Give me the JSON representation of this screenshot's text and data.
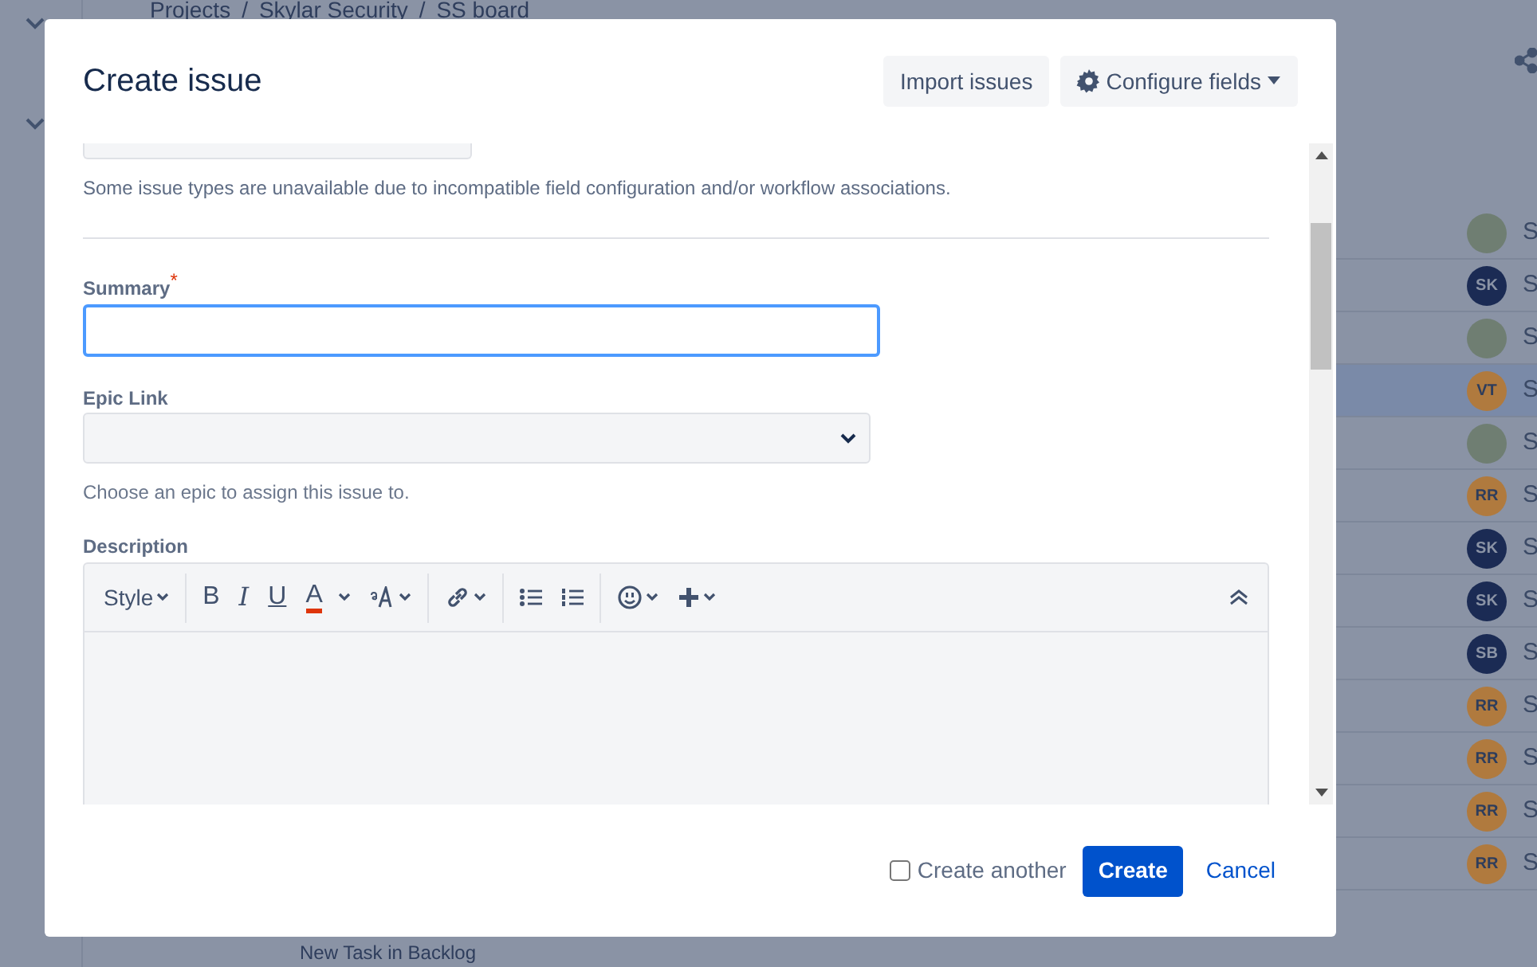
{
  "background": {
    "breadcrumb": {
      "separator": "/",
      "items": [
        "Projects",
        "Skylar Security",
        "SS board"
      ]
    },
    "rows": [
      {
        "kind": "photo",
        "selected": false,
        "key": "S"
      },
      {
        "kind": "initials",
        "initials": "SK",
        "color": "#1b2b54",
        "selected": false,
        "key": "S"
      },
      {
        "kind": "photo",
        "selected": false,
        "key": "S"
      },
      {
        "kind": "initials",
        "initials": "VT",
        "color": "#b07a3e",
        "selected": true,
        "key": "S"
      },
      {
        "kind": "photo",
        "selected": false,
        "key": "S"
      },
      {
        "kind": "initials",
        "initials": "RR",
        "color": "#b07a3e",
        "selected": false,
        "key": "S"
      },
      {
        "kind": "initials",
        "initials": "SK",
        "color": "#1b2b54",
        "selected": false,
        "key": "S"
      },
      {
        "kind": "initials",
        "initials": "SK",
        "color": "#1b2b54",
        "selected": false,
        "key": "S"
      },
      {
        "kind": "initials",
        "initials": "SB",
        "color": "#1b2b54",
        "selected": false,
        "key": "S"
      },
      {
        "kind": "initials",
        "initials": "RR",
        "color": "#b07a3e",
        "selected": false,
        "key": "S"
      },
      {
        "kind": "initials",
        "initials": "RR",
        "color": "#b07a3e",
        "selected": false,
        "key": "S"
      },
      {
        "kind": "initials",
        "initials": "RR",
        "color": "#b07a3e",
        "selected": false,
        "key": "S"
      },
      {
        "kind": "initials",
        "initials": "RR",
        "color": "#b07a3e",
        "selected": false,
        "key": "S"
      }
    ],
    "backlog_text": "New Task in Backlog"
  },
  "dialog": {
    "title": "Create issue",
    "header_buttons": [
      {
        "label": "Import issues",
        "kind": "plain"
      },
      {
        "label": "Configure fields",
        "kind": "settings"
      }
    ],
    "issue_type_note": "Some issue types are unavailable due to incompatible field configuration and/or workflow associations.",
    "summary": {
      "label": "Summary",
      "required_mark": "*",
      "focused": true
    },
    "epic_link": {
      "label": "Epic Link",
      "help": "Choose an epic to assign this issue to."
    },
    "description": {
      "label": "Description",
      "toolbar": [
        {
          "kind": "style",
          "label": "Style"
        },
        {
          "kind": "sep"
        },
        {
          "kind": "bold",
          "label": "B"
        },
        {
          "kind": "italic",
          "label": "I"
        },
        {
          "kind": "underline",
          "label": "U"
        },
        {
          "kind": "color",
          "label": "A"
        },
        {
          "kind": "size"
        },
        {
          "kind": "sep"
        },
        {
          "kind": "link"
        },
        {
          "kind": "sep"
        },
        {
          "kind": "bullets"
        },
        {
          "kind": "numbers"
        },
        {
          "kind": "sep"
        },
        {
          "kind": "emoji"
        },
        {
          "kind": "insert"
        },
        {
          "kind": "collapse"
        }
      ]
    },
    "footer": {
      "create_another": {
        "label": "Create another",
        "checked": false
      },
      "create_label": "Create",
      "cancel_label": "Cancel"
    }
  }
}
